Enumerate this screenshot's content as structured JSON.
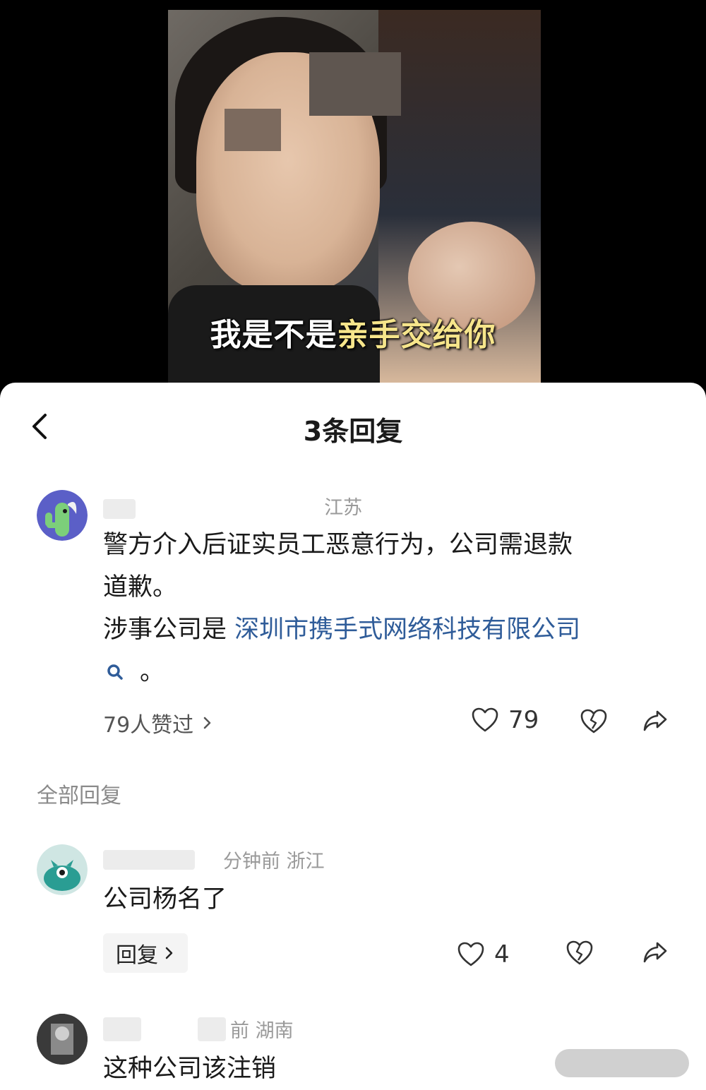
{
  "video": {
    "subtitle_white": "我是不是",
    "subtitle_yellow": "亲手交给你"
  },
  "header": {
    "title": "3条回复"
  },
  "main_comment": {
    "location": "江苏",
    "text_line1": "警方介入后证实员工恶意行为，公司需退款",
    "text_line2": "道歉。",
    "text_prefix": "涉事公司是 ",
    "company_link": "深圳市携手式网络科技有限公司",
    "text_suffix": "。",
    "liked_by": "79人赞过",
    "like_count": "79"
  },
  "replies_section": {
    "label": "全部回复"
  },
  "replies": [
    {
      "meta": "分钟前 浙江",
      "text": "公司杨名了",
      "reply_label": "回复",
      "like_count": "4"
    },
    {
      "meta": "前 湖南",
      "text": "这种公司该注销"
    }
  ],
  "icons": [
    "chevron-left-icon",
    "heart-icon",
    "broken-heart-icon",
    "share-icon",
    "search-icon",
    "chevron-right-icon"
  ],
  "colors": {
    "link": "#2f5c99",
    "subtitle_yellow": "#f6e58b",
    "avatar1": "#5b5fc7",
    "avatar1_figure": "#7ccf7a",
    "avatar2": "#cfe6e3",
    "avatar2_figure": "#2a9d93"
  }
}
